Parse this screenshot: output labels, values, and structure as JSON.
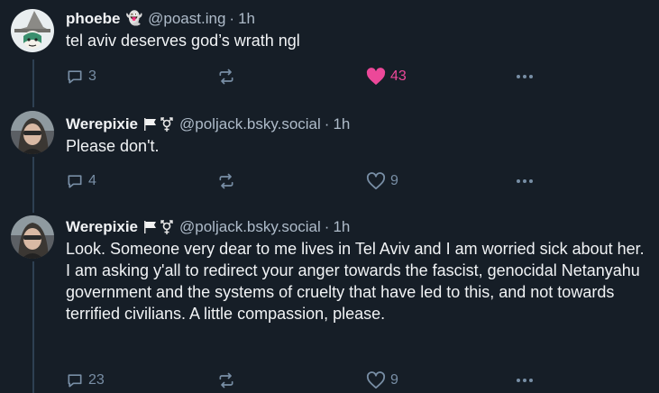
{
  "posts": [
    {
      "display_name": "phoebe",
      "emoji": "👻",
      "handle": "@poast.ing",
      "separator": "·",
      "time": "1h",
      "text": "tel aviv deserves god’s wrath ngl",
      "replies": "3",
      "likes": "43",
      "liked": true,
      "avatar_icon": "witch-hat-avatar"
    },
    {
      "display_name": "Werepixie",
      "emoji_icons": [
        "white-flag-icon",
        "transgender-symbol-icon"
      ],
      "handle": "@poljack.bsky.social",
      "separator": "·",
      "time": "1h",
      "text": "Please don't.",
      "replies": "4",
      "likes": "9",
      "liked": false,
      "avatar_icon": "photo-avatar"
    },
    {
      "display_name": "Werepixie",
      "emoji_icons": [
        "white-flag-icon",
        "transgender-symbol-icon"
      ],
      "handle": "@poljack.bsky.social",
      "separator": "·",
      "time": "1h",
      "text": "Look. Someone very dear to me lives in Tel Aviv and I am worried sick about her. I am asking y'all to redirect your anger towards the fascist, genocidal Netanyahu government and the systems of cruelty that have led to this, and not towards terrified civilians. A little compassion, please.",
      "replies": "23",
      "likes": "9",
      "liked": false,
      "avatar_icon": "photo-avatar"
    }
  ],
  "colors": {
    "background": "#161e27",
    "text": "#f1f3f5",
    "muted": "#aebbc9",
    "action": "#788ea5",
    "like_active": "#ec4899",
    "thread_line": "#2e4052"
  }
}
